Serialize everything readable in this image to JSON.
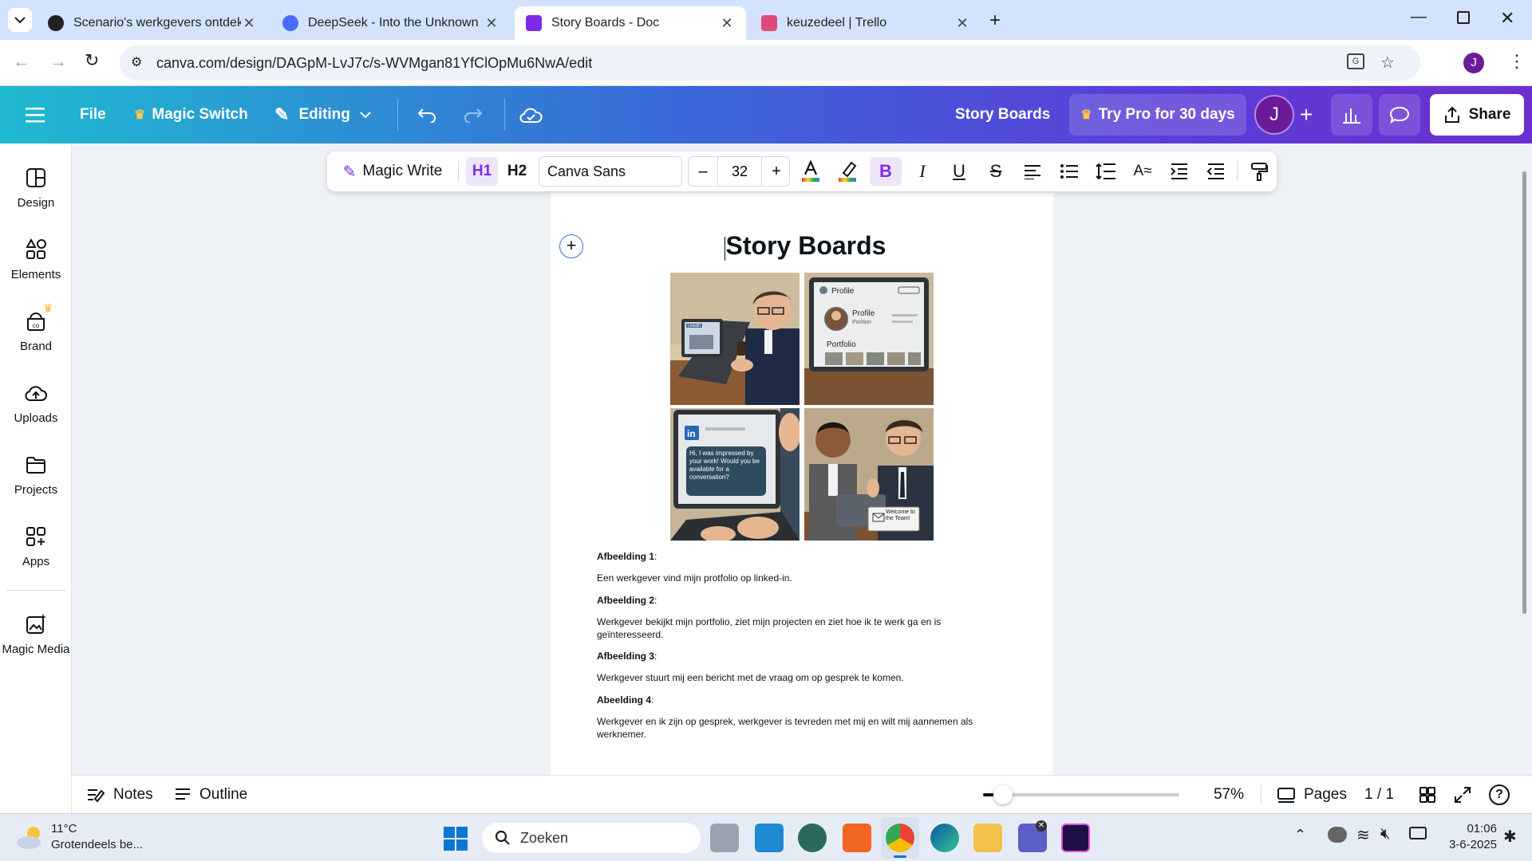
{
  "browser": {
    "tabs": [
      {
        "title": "Scenario's werkgevers ontdekk",
        "color": "#202124"
      },
      {
        "title": "DeepSeek - Into the Unknown",
        "color": "#4d6bfe"
      },
      {
        "title": "Story Boards - Doc",
        "color": "#7d2ae8"
      },
      {
        "title": "keuzedeel | Trello",
        "color": "#e04a7a"
      }
    ],
    "url": "canva.com/design/DAGpM-LvJ7c/s-WVMgan81YfClOpMu6NwA/edit",
    "profile_initial": "J"
  },
  "header": {
    "file": "File",
    "magic_switch": "Magic Switch",
    "mode": "Editing",
    "doc_title": "Story Boards",
    "try_pro": "Try Pro for 30 days",
    "avatar_initial": "J",
    "share": "Share"
  },
  "sidebar": {
    "items": [
      {
        "label": "Design",
        "icon": "design-icon"
      },
      {
        "label": "Elements",
        "icon": "elements-icon"
      },
      {
        "label": "Brand",
        "icon": "brand-icon"
      },
      {
        "label": "Uploads",
        "icon": "uploads-icon"
      },
      {
        "label": "Projects",
        "icon": "projects-icon"
      },
      {
        "label": "Apps",
        "icon": "apps-icon"
      },
      {
        "label": "Magic Media",
        "icon": "magic-media-icon"
      }
    ]
  },
  "toolbar": {
    "magic_write": "Magic Write",
    "h1": "H1",
    "h2": "H2",
    "font": "Canva Sans",
    "minus": "–",
    "size": "32",
    "plus": "+"
  },
  "document": {
    "heading": "Story Boards",
    "panel1": {
      "screen_label": "Linkdin"
    },
    "panel2": {
      "title": "Profile",
      "name": "Profile",
      "position": "Porition",
      "portfolio": "Portfolio"
    },
    "panel3": {
      "logo": "in",
      "message": "Hi, I was impressed by your work! Would you be available for a conversation?"
    },
    "panel4": {
      "card": "Welcome to the Team!"
    },
    "captions": [
      {
        "label": "Afbeelding 1",
        "text": "Een werkgever vind mijn protfolio op linked-in."
      },
      {
        "label": "Afbeelding 2",
        "text": "Werkgever bekijkt mijn portfolio, ziet mijn projecten en ziet hoe ik te werk ga en is geïnteresseerd."
      },
      {
        "label": "Afbeelding 3",
        "text": "Werkgever stuurt mij een bericht met de vraag om op gesprek te komen."
      },
      {
        "label": "Abeelding 4",
        "text": "Werkgever en ik zijn op gesprek, werkgever is tevreden met mij en wilt mij aannemen als werknemer."
      }
    ]
  },
  "bottombar": {
    "notes": "Notes",
    "outline": "Outline",
    "zoom": "57%",
    "zoom_fraction": 0.1,
    "pages": "Pages",
    "page_count": "1 / 1"
  },
  "taskbar": {
    "temp": "11°C",
    "weather": "Grotendeels be...",
    "search": "Zoeken",
    "time": "01:06",
    "date": "3-6-2025"
  }
}
